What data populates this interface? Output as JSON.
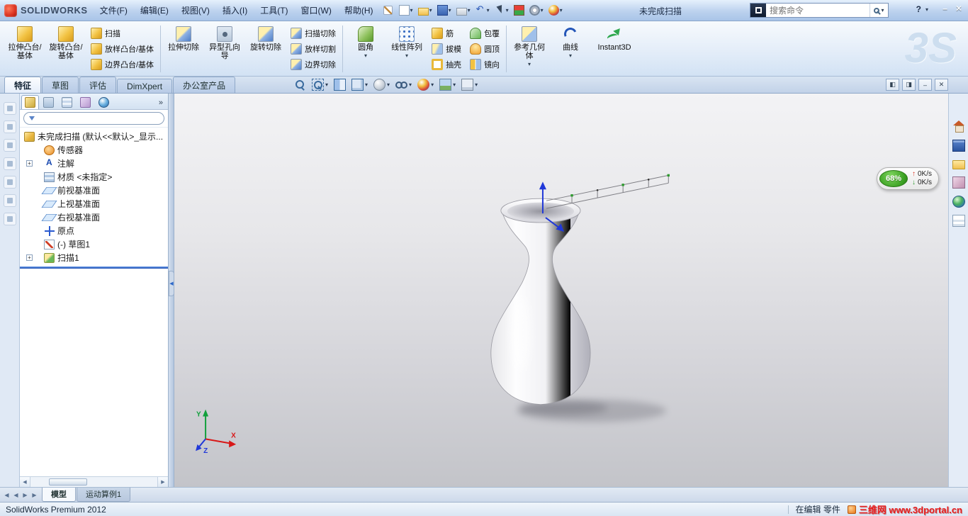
{
  "titlebar": {
    "logo_text": "SOLIDWORKS",
    "menus": [
      "文件(F)",
      "编辑(E)",
      "视图(V)",
      "插入(I)",
      "工具(T)",
      "窗口(W)",
      "帮助(H)"
    ],
    "doc_title": "未完成扫描",
    "search": {
      "placeholder": "搜索命令"
    },
    "help_label": "?",
    "window_controls": [
      "minimize",
      "close"
    ]
  },
  "quick_access_icons": [
    "new-document",
    "open",
    "save",
    "print",
    "undo",
    "select",
    "rebuild",
    "options",
    "edit-color"
  ],
  "ribbon": {
    "large": [
      {
        "label": "拉伸凸台/基体"
      },
      {
        "label": "旋转凸台/基体"
      },
      {
        "label": "拉伸切除"
      },
      {
        "label": "异型孔向导"
      },
      {
        "label": "旋转切除"
      },
      {
        "label": "圆角",
        "dropdown": true
      },
      {
        "label": "线性阵列",
        "dropdown": true
      },
      {
        "label": "参考几何体",
        "dropdown": true
      },
      {
        "label": "曲线",
        "dropdown": true
      },
      {
        "label": "Instant3D"
      }
    ],
    "stack_boss": [
      {
        "label": "扫描",
        "icon": "ri-sweep"
      },
      {
        "label": "放样凸台/基体",
        "icon": "ri-loft"
      },
      {
        "label": "边界凸台/基体",
        "icon": "ri-boundary"
      }
    ],
    "stack_cut": [
      {
        "label": "扫描切除",
        "icon": "ri-sweepcut"
      },
      {
        "label": "放样切割",
        "icon": "ri-loftcut"
      },
      {
        "label": "边界切除",
        "icon": "ri-boundarycut"
      }
    ],
    "stack_feature_a": [
      {
        "label": "筋",
        "icon": "ri-rib"
      },
      {
        "label": "拔模",
        "icon": "ri-draft"
      },
      {
        "label": "抽壳",
        "icon": "ri-shell"
      }
    ],
    "stack_feature_b": [
      {
        "label": "包覆",
        "icon": "ri-wrap"
      },
      {
        "label": "圆顶",
        "icon": "ri-dome"
      },
      {
        "label": "镜向",
        "icon": "ri-mirror"
      }
    ]
  },
  "brand_watermark": "3S",
  "command_tabs": [
    {
      "label": "特征",
      "active": true
    },
    {
      "label": "草图"
    },
    {
      "label": "评估"
    },
    {
      "label": "DimXpert"
    },
    {
      "label": "办公室产品"
    }
  ],
  "headsup_icons": [
    "zoom-to-fit",
    "zoom-to-area",
    "section-view",
    "view-orientation",
    "display-style",
    "hide-show-items",
    "edit-appearance",
    "apply-scene",
    "view-settings"
  ],
  "document_window_buttons": [
    "pane-left",
    "pane-right",
    "minimize-document",
    "close-document"
  ],
  "feature_manager": {
    "tab_icons": [
      "featuremanager-design-tree",
      "propertymanager",
      "configurationmanager",
      "dimxpertmanager",
      "displaymanager"
    ],
    "overflow": "»",
    "root": "未完成扫描 (默认<<默认>_显示...",
    "items": [
      {
        "label": "传感器",
        "icon": "ic-sensor"
      },
      {
        "label": "注解",
        "icon": "ic-annot",
        "plus": true
      },
      {
        "label": "材质 <未指定>",
        "icon": "ic-material"
      },
      {
        "label": "前视基准面",
        "icon": "ic-plane"
      },
      {
        "label": "上视基准面",
        "icon": "ic-plane"
      },
      {
        "label": "右视基准面",
        "icon": "ic-plane"
      },
      {
        "label": "原点",
        "icon": "ic-origin"
      },
      {
        "label": "(-) 草图1",
        "icon": "ic-sketch"
      },
      {
        "label": "扫描1",
        "icon": "ic-sweep",
        "plus": true
      }
    ]
  },
  "left_dock_icons": [
    "dock-tool-1",
    "dock-tool-2",
    "dock-tool-3",
    "dock-tool-4",
    "dock-tool-5",
    "dock-tool-6",
    "dock-tool-7"
  ],
  "right_taskpane_icons": [
    "solidworks-resources",
    "design-library",
    "file-explorer",
    "view-palette",
    "appearances-scenes",
    "custom-properties"
  ],
  "viewport_overlay": {
    "percent": "68%",
    "up_speed": "0K/s",
    "down_speed": "0K/s"
  },
  "triad": {
    "x": "X",
    "y": "Y",
    "z": "Z"
  },
  "bottom_tabs": {
    "scrolls": [
      "◀",
      "◀",
      "▶",
      "▶"
    ],
    "tabs": [
      {
        "label": "模型",
        "active": true
      },
      {
        "label": "运动算例1"
      }
    ]
  },
  "statusbar": {
    "app": "SolidWorks Premium 2012",
    "mode": "在编辑 零件",
    "watermark": "三维网 www.3dportal.cn"
  }
}
